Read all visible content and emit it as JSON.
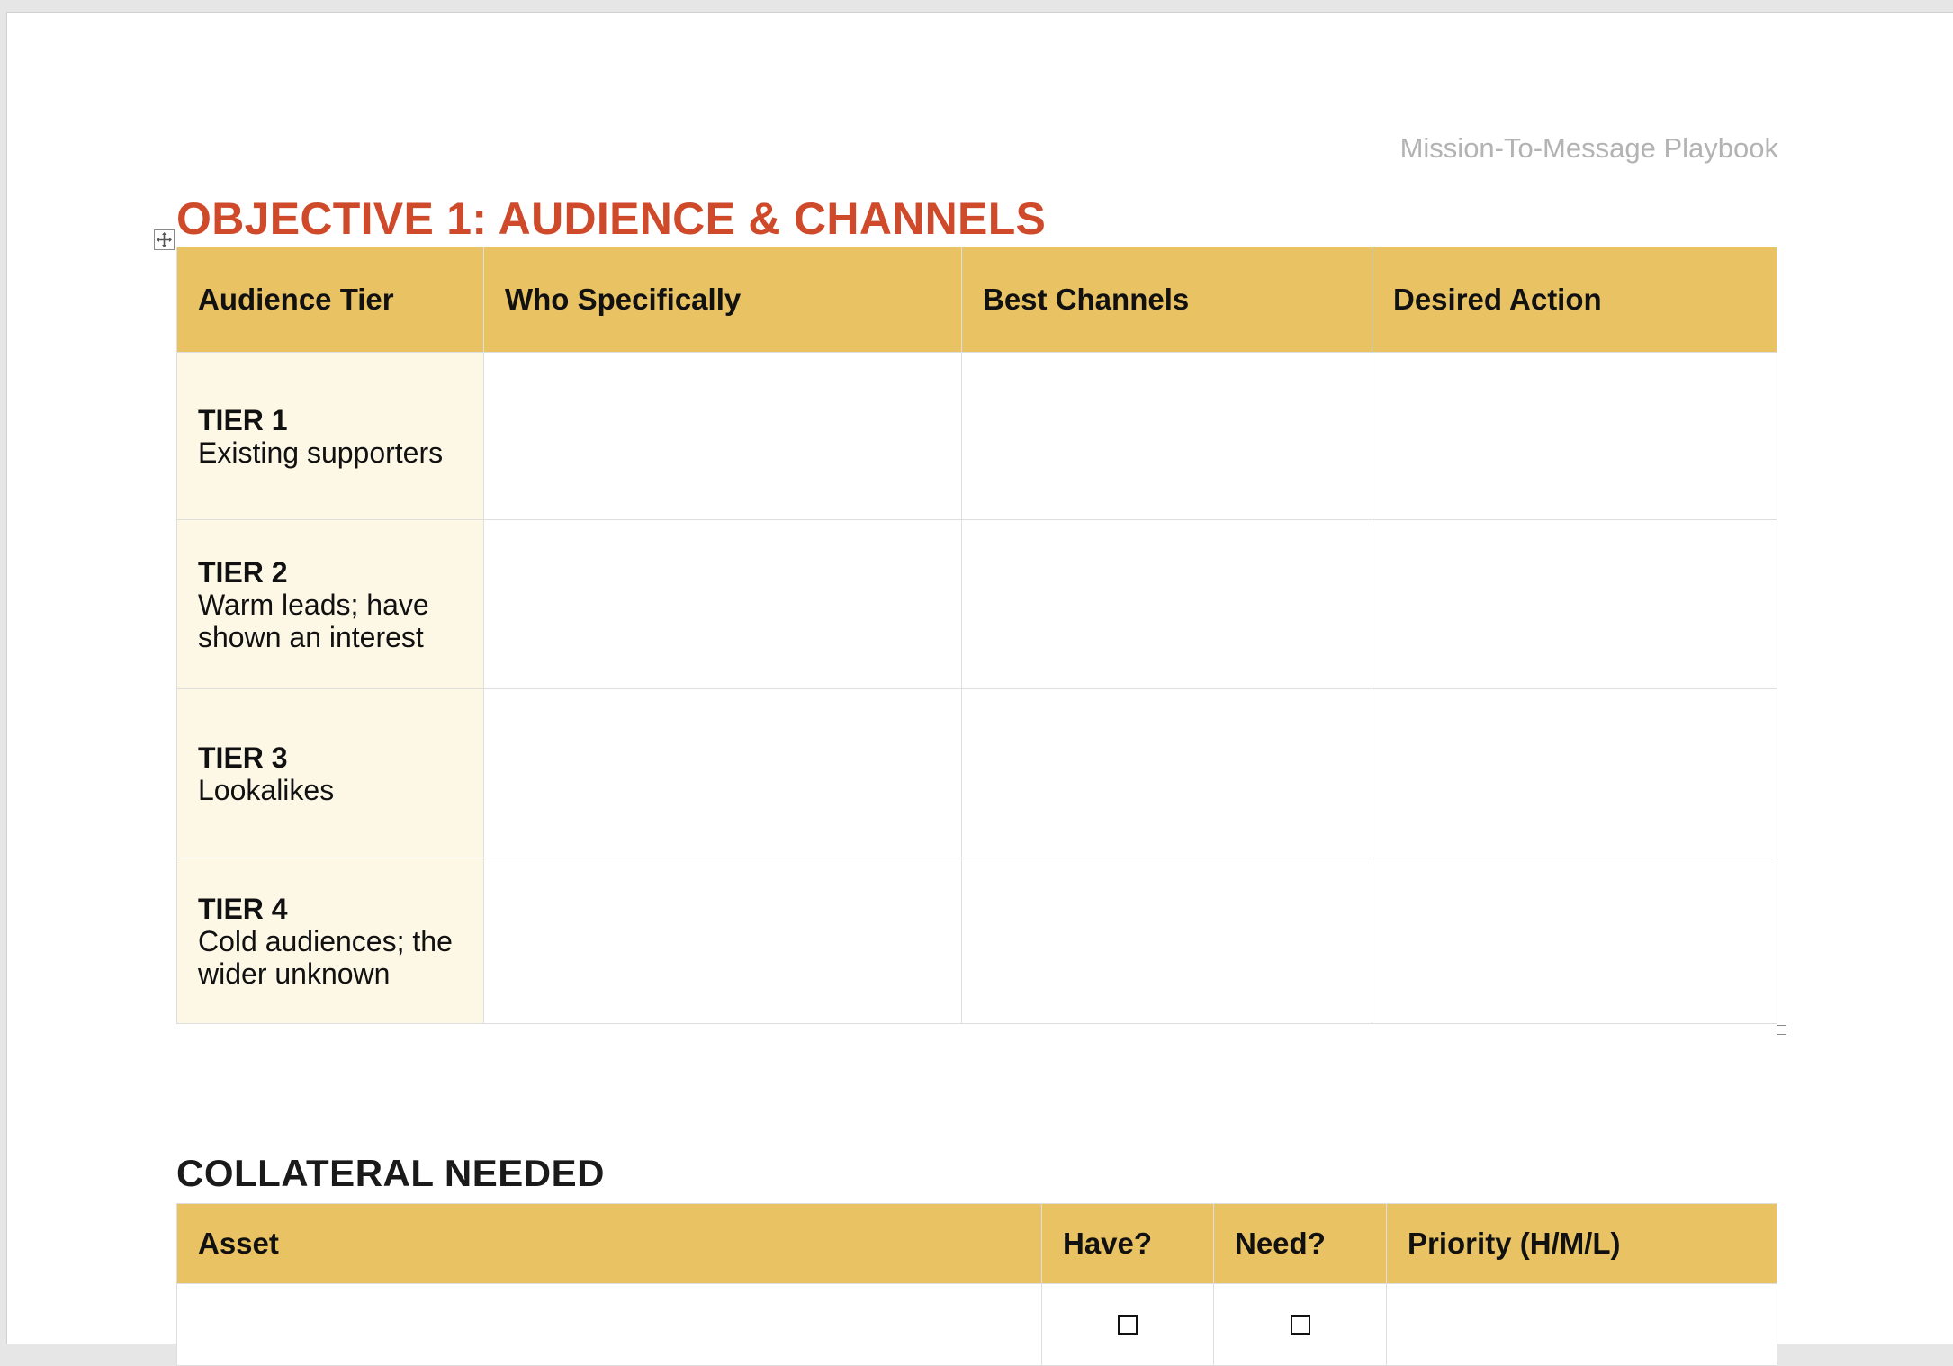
{
  "header": {
    "running_title": "Mission-To-Message Playbook"
  },
  "objective": {
    "title": "OBJECTIVE 1: AUDIENCE & CHANNELS"
  },
  "audience_table": {
    "columns": [
      "Audience Tier",
      "Who Specifically",
      "Best Channels",
      "Desired Action"
    ],
    "rows": [
      {
        "tier": "TIER 1",
        "desc": "Existing supporters"
      },
      {
        "tier": "TIER 2",
        "desc": "Warm leads; have shown an interest"
      },
      {
        "tier": "TIER 3",
        "desc": "Lookalikes"
      },
      {
        "tier": "TIER 4",
        "desc": "Cold audiences; the wider unknown"
      }
    ]
  },
  "collateral": {
    "title": "COLLATERAL NEEDED",
    "columns": [
      "Asset",
      "Have?",
      "Need?",
      "Priority (H/M/L)"
    ],
    "rows": [
      {
        "asset": "",
        "have": false,
        "need": false,
        "priority": ""
      }
    ]
  },
  "icons": {
    "move_handle": "move-icon",
    "resize_handle": "resize-icon",
    "checkbox": "checkbox-icon"
  }
}
